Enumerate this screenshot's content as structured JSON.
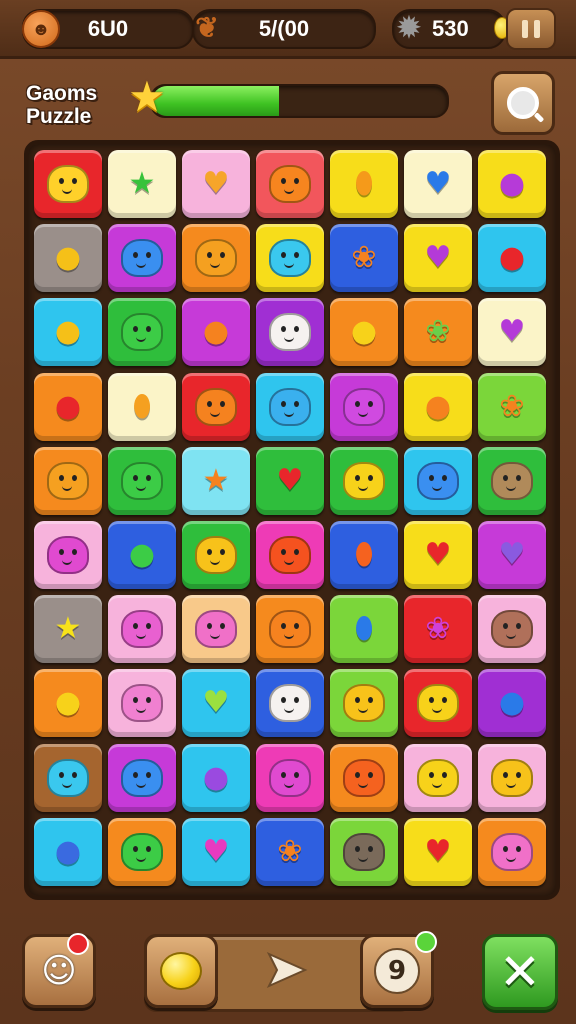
{
  "hud": {
    "lives_value": "6U0",
    "moves_value": "5/(00",
    "gems_value": "530",
    "lives_icon": "smiley-cookie-icon",
    "moves_icon": "leaf-bird-icon",
    "gems_icon": "grey-gear-blob-icon"
  },
  "header": {
    "title_line1": "Gaoms",
    "title_line2": "Puzzle",
    "progress_fraction": 0.43
  },
  "colors": {
    "red": "#e8262b",
    "yellow": "#f7dd1a",
    "pink": "#f7b3dc",
    "salmon": "#f2565c",
    "cream": "#fbf4c8",
    "grey": "#9a8f8a",
    "magenta": "#c63ad8",
    "orange": "#f58a1e",
    "cyan": "#2fc5ee",
    "blue": "#2e5fe0",
    "green": "#2fbe3c",
    "purple": "#a02fd3",
    "lightcyan": "#7fe3f2",
    "peach": "#f8c98a",
    "brown": "#a5652f",
    "lime": "#7bd63a",
    "hotpink": "#ee3bb6"
  },
  "board": {
    "rows": [
      [
        {
          "c": "red",
          "g": "blob",
          "gc": "#ffd12a"
        },
        {
          "c": "cream",
          "g": "star",
          "gc": "#38c23a"
        },
        {
          "c": "pink",
          "g": "heart",
          "gc": "#f6a52a"
        },
        {
          "c": "salmon",
          "g": "blob",
          "gc": "#f7851f"
        },
        {
          "c": "yellow",
          "g": "carrot",
          "gc": "#f59a1a"
        },
        {
          "c": "cream",
          "g": "heart",
          "gc": "#2a7ae8"
        },
        {
          "c": "yellow",
          "g": "apple",
          "gc": "#b63ad8"
        }
      ],
      [
        {
          "c": "grey",
          "g": "apple",
          "gc": "#f5c018"
        },
        {
          "c": "magenta",
          "g": "blob",
          "gc": "#3a8ff0"
        },
        {
          "c": "orange",
          "g": "blob",
          "gc": "#f5a020"
        },
        {
          "c": "yellow",
          "g": "blob",
          "gc": "#3ac8ee"
        },
        {
          "c": "blue",
          "g": "leaf",
          "gc": "#f5821f"
        },
        {
          "c": "yellow",
          "g": "heart",
          "gc": "#b43ad8"
        },
        {
          "c": "cyan",
          "g": "apple",
          "gc": "#e8262b"
        }
      ],
      [
        {
          "c": "cyan",
          "g": "apple",
          "gc": "#f5c018"
        },
        {
          "c": "green",
          "g": "blob",
          "gc": "#3ccc46"
        },
        {
          "c": "magenta",
          "g": "apple",
          "gc": "#f5821f"
        },
        {
          "c": "purple",
          "g": "blob",
          "gc": "#f6f2f0"
        },
        {
          "c": "orange",
          "g": "apple",
          "gc": "#f7d21a"
        },
        {
          "c": "orange",
          "g": "leaf",
          "gc": "#6ad04a"
        },
        {
          "c": "cream",
          "g": "heart",
          "gc": "#b43ad8"
        }
      ],
      [
        {
          "c": "orange",
          "g": "apple",
          "gc": "#e8262b"
        },
        {
          "c": "cream",
          "g": "carrot",
          "gc": "#f5a020"
        },
        {
          "c": "red",
          "g": "blob",
          "gc": "#f5821f"
        },
        {
          "c": "cyan",
          "g": "blob",
          "gc": "#3ab0ee"
        },
        {
          "c": "magenta",
          "g": "blob",
          "gc": "#d04ae0"
        },
        {
          "c": "yellow",
          "g": "apple",
          "gc": "#f5821f"
        },
        {
          "c": "lime",
          "g": "leaf",
          "gc": "#f5821f"
        }
      ],
      [
        {
          "c": "orange",
          "g": "blob",
          "gc": "#f5a020"
        },
        {
          "c": "green",
          "g": "blob",
          "gc": "#3ccc46"
        },
        {
          "c": "lightcyan",
          "g": "star",
          "gc": "#f5821f"
        },
        {
          "c": "green",
          "g": "heart",
          "gc": "#e8262b"
        },
        {
          "c": "green",
          "g": "blob",
          "gc": "#f7d21a"
        },
        {
          "c": "cyan",
          "g": "blob",
          "gc": "#3a8ff0"
        },
        {
          "c": "green",
          "g": "blob",
          "gc": "#b08a5a"
        }
      ],
      [
        {
          "c": "pink",
          "g": "blob",
          "gc": "#e04ad0"
        },
        {
          "c": "blue",
          "g": "apple",
          "gc": "#3ccc46"
        },
        {
          "c": "green",
          "g": "blob",
          "gc": "#f7c21a"
        },
        {
          "c": "hotpink",
          "g": "blob",
          "gc": "#f5521f"
        },
        {
          "c": "blue",
          "g": "carrot",
          "gc": "#f5621f"
        },
        {
          "c": "yellow",
          "g": "heart",
          "gc": "#e8262b"
        },
        {
          "c": "magenta",
          "g": "heart",
          "gc": "#8a5ae0"
        }
      ],
      [
        {
          "c": "grey",
          "g": "star",
          "gc": "#f7e21a"
        },
        {
          "c": "pink",
          "g": "blob",
          "gc": "#e860d0"
        },
        {
          "c": "peach",
          "g": "blob",
          "gc": "#f070c8"
        },
        {
          "c": "orange",
          "g": "blob",
          "gc": "#f5821f"
        },
        {
          "c": "lime",
          "g": "carrot",
          "gc": "#2a7ae8"
        },
        {
          "c": "red",
          "g": "leaf",
          "gc": "#d040d8"
        },
        {
          "c": "pink",
          "g": "blob",
          "gc": "#b0705a"
        }
      ],
      [
        {
          "c": "orange",
          "g": "apple",
          "gc": "#f7d21a"
        },
        {
          "c": "pink",
          "g": "blob",
          "gc": "#f080d0"
        },
        {
          "c": "cyan",
          "g": "heart",
          "gc": "#9ae040"
        },
        {
          "c": "blue",
          "g": "blob",
          "gc": "#f6f2f0"
        },
        {
          "c": "lime",
          "g": "blob",
          "gc": "#f7c21a"
        },
        {
          "c": "red",
          "g": "blob",
          "gc": "#f7d21a"
        },
        {
          "c": "purple",
          "g": "apple",
          "gc": "#2a7ae8"
        }
      ],
      [
        {
          "c": "brown",
          "g": "blob",
          "gc": "#3ac8ee"
        },
        {
          "c": "magenta",
          "g": "blob",
          "gc": "#3a8ff0"
        },
        {
          "c": "cyan",
          "g": "apple",
          "gc": "#9a4ae0"
        },
        {
          "c": "hotpink",
          "g": "blob",
          "gc": "#e04ad0"
        },
        {
          "c": "orange",
          "g": "blob",
          "gc": "#f5621f"
        },
        {
          "c": "pink",
          "g": "blob",
          "gc": "#f7d21a"
        },
        {
          "c": "pink",
          "g": "blob",
          "gc": "#f7c21a"
        }
      ],
      [
        {
          "c": "cyan",
          "g": "apple",
          "gc": "#3a6ae0"
        },
        {
          "c": "orange",
          "g": "blob",
          "gc": "#3ccc46"
        },
        {
          "c": "cyan",
          "g": "heart",
          "gc": "#e83ac0"
        },
        {
          "c": "blue",
          "g": "leaf",
          "gc": "#f5821f"
        },
        {
          "c": "lime",
          "g": "blob",
          "gc": "#7a6a5a"
        },
        {
          "c": "yellow",
          "g": "heart",
          "gc": "#e8262b"
        },
        {
          "c": "orange",
          "g": "blob",
          "gc": "#f070c8"
        }
      ]
    ]
  },
  "bottom": {
    "powerup_icon": "ghost-character-icon",
    "lemon_icon": "lemon-icon",
    "arrow_icon": "play-arrow-icon",
    "hint_icon": "nine-badge-icon",
    "hint_label": "9",
    "close_label": "✕"
  }
}
